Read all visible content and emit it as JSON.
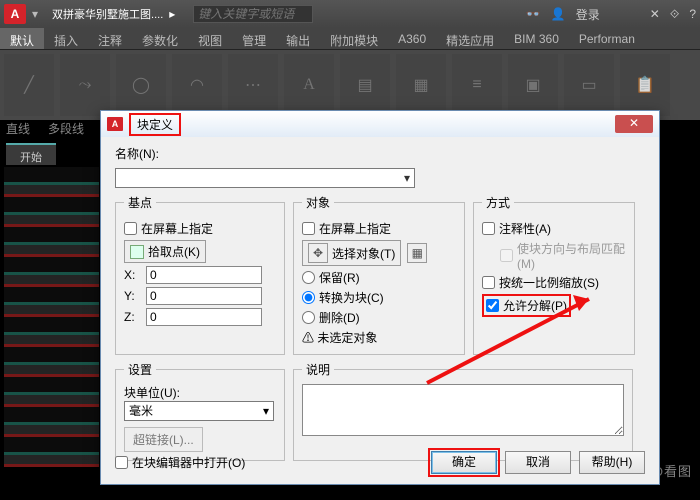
{
  "app": {
    "doc_title": "双拼豪华别墅施工图....",
    "search_placeholder": "键入关键字或短语",
    "login": "登录"
  },
  "tabs": [
    "默认",
    "插入",
    "注释",
    "参数化",
    "视图",
    "管理",
    "输出",
    "附加模块",
    "A360",
    "精选应用",
    "BIM 360",
    "Performan"
  ],
  "ribbon_labels": [
    "直线",
    "多段线"
  ],
  "start_tab": "开始",
  "dialog": {
    "title": "块定义",
    "name_label": "名称(N):",
    "groups": {
      "base": {
        "legend": "基点",
        "specify": "在屏幕上指定",
        "pick": "拾取点(K)",
        "x": "X:",
        "y": "Y:",
        "z": "Z:",
        "xv": "0",
        "yv": "0",
        "zv": "0"
      },
      "object": {
        "legend": "对象",
        "specify": "在屏幕上指定",
        "select": "选择对象(T)",
        "keep": "保留(R)",
        "convert": "转换为块(C)",
        "delete": "删除(D)",
        "warn": "⚠ 未选定对象"
      },
      "mode": {
        "legend": "方式",
        "annot": "注释性(A)",
        "match": "使块方向与布局匹配(M)",
        "uniform": "按统一比例缩放(S)",
        "explode": "允许分解(P)"
      },
      "settings": {
        "legend": "设置",
        "unit_label": "块单位(U):",
        "unit_value": "毫米",
        "hyperlink": "超链接(L)..."
      },
      "desc": {
        "legend": "说明"
      }
    },
    "footer": {
      "open_editor": "在块编辑器中打开(O)",
      "ok": "确定",
      "cancel": "取消",
      "help": "帮助(H)"
    }
  },
  "watermark": "知乎 @迅捷CAD看图"
}
